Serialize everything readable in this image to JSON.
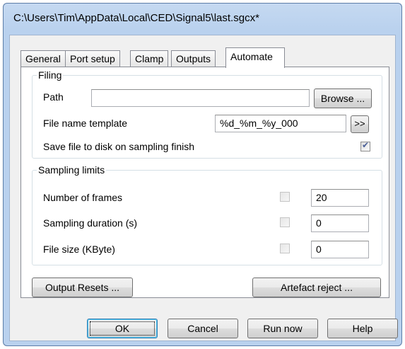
{
  "window": {
    "title": "C:\\Users\\Tim\\AppData\\Local\\CED\\Signal5\\last.sgcx*"
  },
  "tabs": [
    {
      "label": "General",
      "active": false
    },
    {
      "label": "Port setup",
      "active": false
    },
    {
      "label": "Clamp",
      "active": false
    },
    {
      "label": "Outputs",
      "active": false
    },
    {
      "label": "Automate",
      "active": true
    }
  ],
  "filing": {
    "legend": "Filing",
    "path_label": "Path",
    "path_value": "",
    "browse_label": "Browse ...",
    "template_label": "File name template",
    "template_value": "%d_%m_%y_000",
    "template_button": ">>",
    "save_label": "Save file to disk on sampling finish",
    "save_checked": true
  },
  "sampling": {
    "legend": "Sampling limits",
    "rows": [
      {
        "label": "Number of frames",
        "checked": false,
        "value": "20"
      },
      {
        "label": "Sampling duration (s)",
        "checked": false,
        "value": "0"
      },
      {
        "label": "File size (KByte)",
        "checked": false,
        "value": "0"
      }
    ]
  },
  "panel_buttons": {
    "output_resets": "Output Resets ...",
    "artefact_reject": "Artefact reject ..."
  },
  "dialog_buttons": {
    "ok": "OK",
    "cancel": "Cancel",
    "run_now": "Run now",
    "help": "Help"
  }
}
